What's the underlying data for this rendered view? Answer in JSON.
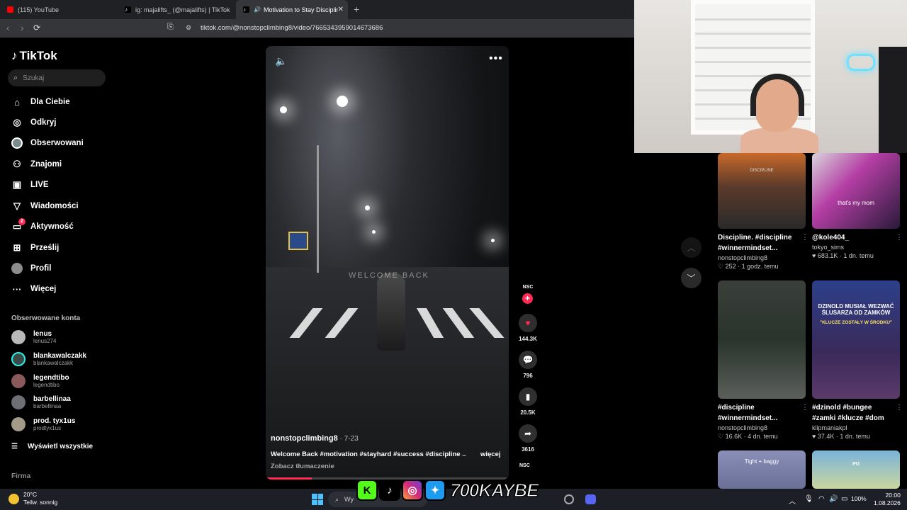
{
  "browser": {
    "tabs": [
      {
        "title": "(115) YouTube",
        "favicon_color": "#ff0000"
      },
      {
        "title": "ig: majalifts_ (@majalifts) | TikTok",
        "favicon_color": "#ffffff"
      },
      {
        "title": "Motivation to Stay Disciplined",
        "favicon_color": "#ffffff"
      }
    ],
    "close_tab": "✕",
    "new_tab": "+",
    "url": "tiktok.com/@nonstopclimbing8/video/7665343959014673686"
  },
  "sidebar": {
    "logo": "TikTok",
    "search_placeholder": "Szukaj",
    "nav": [
      {
        "label": "Dla Ciebie",
        "icon": "home-icon"
      },
      {
        "label": "Odkryj",
        "icon": "compass-icon"
      },
      {
        "label": "Obserwowani",
        "icon": "following-avatar-icon"
      },
      {
        "label": "Znajomi",
        "icon": "friends-icon"
      },
      {
        "label": "LIVE",
        "icon": "live-icon"
      },
      {
        "label": "Wiadomości",
        "icon": "send-icon"
      },
      {
        "label": "Aktywność",
        "icon": "activity-icon",
        "badge": "2"
      },
      {
        "label": "Prześlij",
        "icon": "upload-icon"
      },
      {
        "label": "Profil",
        "icon": "profile-avatar-icon"
      },
      {
        "label": "Więcej",
        "icon": "more-icon"
      }
    ],
    "following_heading": "Obserwowane konta",
    "accounts": [
      {
        "name": "lenus",
        "handle": "lenus274"
      },
      {
        "name": "blankawalczakk",
        "handle": "blankawalczakk"
      },
      {
        "name": "legendtibo",
        "handle": "legendtibo"
      },
      {
        "name": "barbellinaa",
        "handle": "barbellinaa"
      },
      {
        "name": "prod. tyx1us",
        "handle": "prodtyx1us"
      }
    ],
    "see_all": "Wyświetl wszystkie",
    "footer": "Firma"
  },
  "video": {
    "overlay_text": "WELCOME BACK",
    "author": "nonstopclimbing8",
    "date": " · 7-23",
    "description": "Welcome Back #motivation #stayhard #success #discipline ...",
    "more": "więcej",
    "translate": "Zobacz tłumaczenie",
    "progress_fraction": 0.19
  },
  "actions": {
    "avatar_text": "NSC",
    "follow": "+",
    "likes": "144.3K",
    "comments": "796",
    "saves": "20.5K",
    "shares": "3616",
    "music_text": "NSC",
    "like_color": "#fe2c55"
  },
  "recommended": [
    {
      "title": "Discipline. #discipline #winnermindset...",
      "author": "nonstopclimbing8",
      "likes": "252",
      "age": "1 godz. temu",
      "thumb_text": "DISCIPLINE"
    },
    {
      "title": "@kole404_",
      "author": "tokyo_sims",
      "likes": "683.1K",
      "age": "1 dn. temu",
      "thumb_text": "that's my mom"
    },
    {
      "title": "#discipline #winnermindset...",
      "author": "nonstopclimbing8",
      "likes": "16.6K",
      "age": "4 dn. temu",
      "thumb_text": ""
    },
    {
      "title": "#dzinold #bungee #zamki #klucze #dom",
      "author": "klipmaniakpl",
      "likes": "37.4K",
      "age": "1 dn. temu",
      "thumb_text": "DZINOLD MUSIAŁ WEZWAĆ ŚLUSARZA OD ZAMKÓW",
      "thumb_sub": "\"KLUCZE ZOSTAŁY W ŚRODKU\""
    },
    {
      "title": "",
      "author": "",
      "likes": "",
      "age": "",
      "thumb_text": "Tight + baggy"
    },
    {
      "title": "",
      "author": "",
      "likes": "",
      "age": "",
      "thumb_text": "PO"
    }
  ],
  "taskbar": {
    "temperature": "20°C",
    "weather": "Teilw. sonnig",
    "search": "Wy",
    "battery": "100%",
    "time": "20:00",
    "date": "1.08.2026",
    "social_handle": "700KAYBE"
  }
}
